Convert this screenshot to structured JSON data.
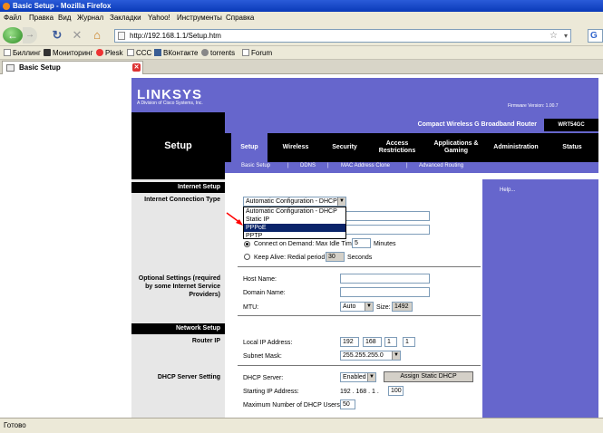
{
  "window": {
    "title": "Basic Setup - Mozilla Firefox"
  },
  "menubar": {
    "items": [
      "Файл",
      "Правка",
      "Вид",
      "Журнал",
      "Закладки",
      "Yahoo!",
      "Инструменты",
      "Справка"
    ]
  },
  "nav": {
    "url": "http://192.168.1.1/Setup.htm",
    "search_letter": "G"
  },
  "bookmarks": {
    "items": [
      "Биллинг",
      "Мониторинг",
      "Plesk",
      "CCC",
      "ВКонтакте",
      "torrents",
      "Forum"
    ]
  },
  "tab": {
    "title": "Basic Setup"
  },
  "status": {
    "text": "Готово"
  },
  "router": {
    "logo": "LINKSYS",
    "logo_sub": "A Division of Cisco Systems, Inc.",
    "firmware": "Firmware Version: 1.00.7",
    "product": "Compact Wireless G Broadband Router",
    "model": "WRT54GC",
    "page_title": "Setup",
    "tabs": [
      "Setup",
      "Wireless",
      "Security",
      "Access Restrictions",
      "Applications & Gaming",
      "Administration",
      "Status"
    ],
    "subtabs": [
      "Basic Setup",
      "DDNS",
      "MAC Address Clone",
      "Advanced Routing"
    ],
    "subtab_sep": "|",
    "help": "Help...",
    "sections": {
      "internet_setup": "Internet Setup",
      "connection_type": "Internet Connection Type",
      "optional": "Optional Settings (required by some Internet Service Providers)",
      "network_setup": "Network Setup",
      "router_ip": "Router IP",
      "dhcp": "DHCP Server Setting"
    },
    "connection": {
      "selected": "Automatic Configuration - DHCP",
      "options": [
        "Automatic Configuration - DHCP",
        "Static IP",
        "PPPoE",
        "PPTP"
      ],
      "highlighted": "PPPoE"
    },
    "connect_on_demand": {
      "label": "Connect on Demand: Max Idle Time",
      "value": "5",
      "unit": "Minutes"
    },
    "keep_alive": {
      "label": "Keep Alive: Redial period",
      "value": "30",
      "unit": "Seconds"
    },
    "optional": {
      "host_label": "Host Name:",
      "host_value": "",
      "domain_label": "Domain Name:",
      "domain_value": "",
      "mtu_label": "MTU:",
      "mtu_value": "Auto",
      "size_label": "Size:",
      "size_value": "1492"
    },
    "network": {
      "local_ip_label": "Local IP Address:",
      "ip": [
        "192",
        "168",
        "1",
        "1"
      ],
      "subnet_label": "Subnet Mask:",
      "subnet_value": "255.255.255.0"
    },
    "dhcp": {
      "server_label": "DHCP Server:",
      "server_value": "Enabled",
      "assign_button": "Assign Static DHCP",
      "start_label": "Starting IP Address:",
      "start_prefix": "192 . 168 . 1 .",
      "start_value": "100",
      "max_label": "Maximum Number of DHCP Users:",
      "max_value": "50"
    }
  },
  "colors": {
    "linksys_purple": "#6666cc",
    "highlight": "#0a246a",
    "arrow": "#ff0000"
  }
}
